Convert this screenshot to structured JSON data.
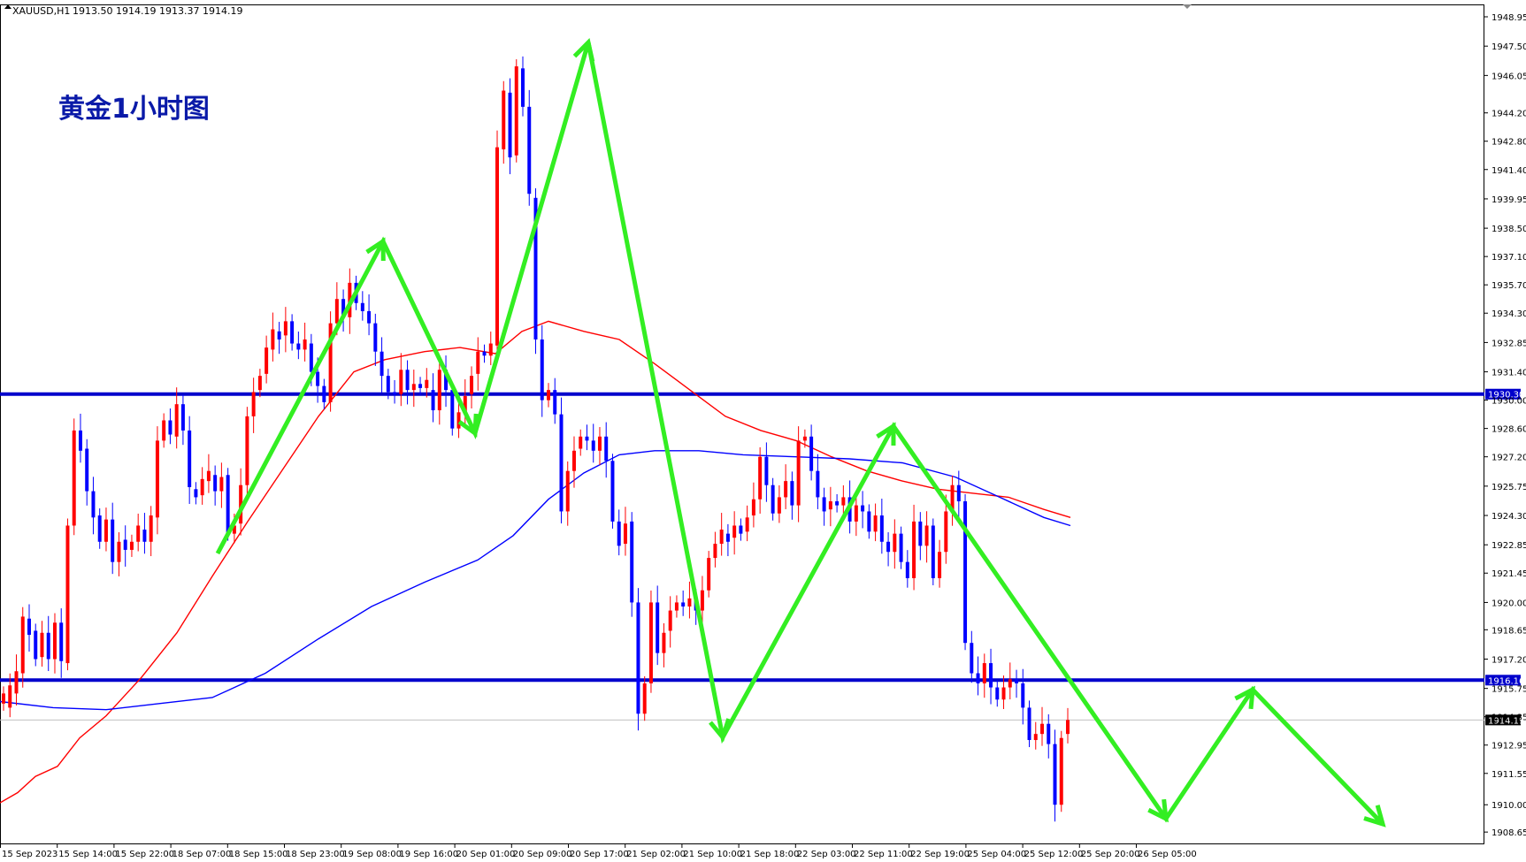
{
  "header": {
    "symbol": "XAUUSD,H1",
    "ohlc": "1913.50 1914.19 1913.37 1914.19"
  },
  "annotation_title": "黄金1小时图",
  "colors": {
    "bull": "#ff0000",
    "bear": "#0000ff",
    "level": "#0000cc",
    "arrow": "#33ee22",
    "ma_fast": "#ff0000",
    "ma_slow": "#0000ff",
    "badge": "#000000"
  },
  "chart_data": {
    "type": "line",
    "title": "黄金1小时图",
    "symbol": "XAUUSD",
    "timeframe": "H1",
    "ylim": [
      1908.35,
      1948.95
    ],
    "y_ticks": [
      "1948.95",
      "1947.50",
      "1946.05",
      "1944.20",
      "1942.80",
      "1941.40",
      "1939.95",
      "1938.50",
      "1937.10",
      "1935.70",
      "1934.30",
      "1932.85",
      "1931.40",
      "1930.00",
      "1928.60",
      "1927.20",
      "1925.75",
      "1924.30",
      "1922.85",
      "1921.45",
      "1920.00",
      "1918.65",
      "1917.20",
      "1915.75",
      "1914.35",
      "1912.95",
      "1911.55",
      "1910.00",
      "1908.65"
    ],
    "x_ticks": [
      "15 Sep 2023",
      "15 Sep 14:00",
      "15 Sep 22:00",
      "18 Sep 07:00",
      "18 Sep 15:00",
      "18 Sep 23:00",
      "19 Sep 08:00",
      "19 Sep 16:00",
      "20 Sep 01:00",
      "20 Sep 09:00",
      "20 Sep 17:00",
      "21 Sep 02:00",
      "21 Sep 10:00",
      "21 Sep 18:00",
      "22 Sep 03:00",
      "22 Sep 11:00",
      "22 Sep 19:00",
      "25 Sep 04:00",
      "25 Sep 12:00",
      "25 Sep 20:00",
      "26 Sep 05:00"
    ],
    "price_levels": [
      1930.3,
      1916.16
    ],
    "current_price": 1914.19,
    "candles": [
      [
        1915.0,
        1915.5
      ],
      [
        1914.8,
        1915.9
      ],
      [
        1915.5,
        1916.6
      ],
      [
        1916.5,
        1919.3
      ],
      [
        1919.2,
        1918.4
      ],
      [
        1918.6,
        1917.2
      ],
      [
        1917.3,
        1918.5
      ],
      [
        1918.5,
        1917.2
      ],
      [
        1917.2,
        1919.0
      ],
      [
        1919.0,
        1917.1
      ],
      [
        1917.0,
        1923.8
      ],
      [
        1923.8,
        1928.5
      ],
      [
        1928.5,
        1927.5
      ],
      [
        1927.6,
        1925.5
      ],
      [
        1925.5,
        1924.2
      ],
      [
        1924.3,
        1923.0
      ],
      [
        1923.0,
        1924.1
      ],
      [
        1924.1,
        1922.0
      ],
      [
        1922.0,
        1923.0
      ],
      [
        1923.1,
        1922.6
      ],
      [
        1922.6,
        1923.0
      ],
      [
        1923.0,
        1923.8
      ],
      [
        1923.6,
        1923.0
      ],
      [
        1923.0,
        1924.3
      ],
      [
        1924.2,
        1928.0
      ],
      [
        1928.0,
        1929.0
      ],
      [
        1929.0,
        1928.3
      ],
      [
        1928.2,
        1929.8
      ],
      [
        1929.8,
        1928.5
      ],
      [
        1928.5,
        1925.7
      ],
      [
        1925.6,
        1925.2
      ],
      [
        1925.3,
        1926.1
      ],
      [
        1926.0,
        1926.5
      ],
      [
        1926.3,
        1925.5
      ],
      [
        1925.5,
        1926.2
      ],
      [
        1926.3,
        1923.4
      ],
      [
        1923.4,
        1923.8
      ],
      [
        1923.9,
        1925.8
      ],
      [
        1925.8,
        1929.2
      ],
      [
        1929.2,
        1930.4
      ],
      [
        1930.5,
        1931.2
      ],
      [
        1931.3,
        1932.6
      ],
      [
        1932.5,
        1933.5
      ],
      [
        1933.4,
        1933.0
      ],
      [
        1933.2,
        1933.9
      ],
      [
        1933.9,
        1932.8
      ],
      [
        1932.8,
        1932.5
      ],
      [
        1932.5,
        1933.0
      ],
      [
        1932.8,
        1931.4
      ],
      [
        1931.4,
        1930.7
      ],
      [
        1930.7,
        1929.9
      ],
      [
        1929.9,
        1933.8
      ],
      [
        1933.8,
        1935.0
      ],
      [
        1935.0,
        1934.1
      ],
      [
        1934.1,
        1935.8
      ],
      [
        1935.8,
        1934.8
      ],
      [
        1934.8,
        1934.4
      ],
      [
        1934.4,
        1933.8
      ],
      [
        1933.8,
        1932.4
      ],
      [
        1932.4,
        1931.2
      ],
      [
        1931.2,
        1930.4
      ],
      [
        1930.4,
        1930.3
      ],
      [
        1930.3,
        1931.5
      ],
      [
        1931.5,
        1930.5
      ],
      [
        1930.5,
        1930.8
      ],
      [
        1930.8,
        1930.6
      ],
      [
        1930.6,
        1931.0
      ],
      [
        1930.5,
        1929.5
      ],
      [
        1929.5,
        1931.5
      ],
      [
        1931.5,
        1930.5
      ],
      [
        1930.5,
        1928.6
      ],
      [
        1928.6,
        1929.4
      ],
      [
        1929.4,
        1930.2
      ],
      [
        1930.3,
        1931.2
      ],
      [
        1931.3,
        1932.4
      ],
      [
        1932.4,
        1932.2
      ],
      [
        1932.2,
        1932.8
      ],
      [
        1932.7,
        1942.5
      ],
      [
        1942.4,
        1945.3
      ],
      [
        1945.2,
        1942.0
      ],
      [
        1942.1,
        1946.5
      ],
      [
        1946.4,
        1944.5
      ],
      [
        1944.5,
        1940.2
      ],
      [
        1940.0,
        1933.0
      ],
      [
        1933.0,
        1930.0
      ],
      [
        1930.0,
        1930.5
      ],
      [
        1930.5,
        1929.3
      ],
      [
        1929.3,
        1924.5
      ],
      [
        1924.5,
        1926.5
      ],
      [
        1926.5,
        1927.5
      ],
      [
        1927.6,
        1928.2
      ],
      [
        1928.2,
        1928.0
      ],
      [
        1928.0,
        1927.5
      ],
      [
        1927.5,
        1928.2
      ],
      [
        1928.2,
        1927.0
      ],
      [
        1927.0,
        1924.0
      ],
      [
        1924.0,
        1922.8
      ],
      [
        1922.9,
        1923.9
      ],
      [
        1924.0,
        1920.0
      ],
      [
        1920.0,
        1914.5
      ],
      [
        1914.5,
        1916.0
      ],
      [
        1916.0,
        1920.0
      ],
      [
        1920.0,
        1917.5
      ],
      [
        1917.5,
        1918.5
      ],
      [
        1918.6,
        1919.6
      ],
      [
        1919.6,
        1920.0
      ],
      [
        1920.0,
        1919.8
      ],
      [
        1919.8,
        1920.2
      ],
      [
        1920.2,
        1919.6
      ],
      [
        1919.6,
        1920.6
      ],
      [
        1920.6,
        1922.2
      ],
      [
        1922.2,
        1922.9
      ],
      [
        1922.9,
        1923.6
      ],
      [
        1923.4,
        1923.0
      ],
      [
        1923.2,
        1923.8
      ],
      [
        1923.8,
        1923.4
      ],
      [
        1923.5,
        1924.2
      ],
      [
        1924.3,
        1925.1
      ],
      [
        1925.1,
        1927.2
      ],
      [
        1927.2,
        1925.8
      ],
      [
        1925.8,
        1924.4
      ],
      [
        1924.4,
        1925.2
      ],
      [
        1925.2,
        1926.0
      ],
      [
        1926.0,
        1924.8
      ],
      [
        1924.8,
        1928.0
      ],
      [
        1928.0,
        1928.2
      ],
      [
        1928.2,
        1926.5
      ],
      [
        1926.5,
        1925.2
      ],
      [
        1925.2,
        1924.5
      ],
      [
        1924.6,
        1925.0
      ],
      [
        1925.0,
        1924.8
      ],
      [
        1924.8,
        1925.2
      ],
      [
        1925.2,
        1924.0
      ],
      [
        1924.0,
        1924.8
      ],
      [
        1924.8,
        1924.5
      ],
      [
        1924.5,
        1923.5
      ],
      [
        1923.5,
        1924.3
      ],
      [
        1924.3,
        1923.0
      ],
      [
        1923.0,
        1922.5
      ],
      [
        1922.5,
        1923.4
      ],
      [
        1923.4,
        1922.0
      ],
      [
        1922.0,
        1921.2
      ],
      [
        1921.2,
        1924.0
      ],
      [
        1924.0,
        1922.8
      ],
      [
        1922.8,
        1923.8
      ],
      [
        1923.8,
        1921.2
      ],
      [
        1921.2,
        1922.5
      ],
      [
        1922.5,
        1924.5
      ],
      [
        1924.5,
        1925.8
      ],
      [
        1925.8,
        1925.0
      ],
      [
        1925.0,
        1918.0
      ],
      [
        1918.0,
        1916.5
      ],
      [
        1916.5,
        1916.0
      ],
      [
        1916.0,
        1917.0
      ],
      [
        1917.0,
        1915.8
      ],
      [
        1915.8,
        1915.2
      ],
      [
        1915.2,
        1915.8
      ],
      [
        1915.8,
        1916.2
      ],
      [
        1916.2,
        1916.0
      ],
      [
        1916.0,
        1914.8
      ],
      [
        1914.8,
        1913.2
      ],
      [
        1913.2,
        1913.5
      ],
      [
        1913.5,
        1914.0
      ],
      [
        1914.0,
        1913.0
      ],
      [
        1913.0,
        1910.0
      ],
      [
        1910.0,
        1913.3
      ],
      [
        1913.5,
        1914.19
      ]
    ],
    "series": [
      {
        "name": "MA",
        "color": "#ff0000",
        "values": [
          [
            0,
            1910.1
          ],
          [
            20,
            1910.6
          ],
          [
            40,
            1911.4
          ],
          [
            65,
            1911.9
          ],
          [
            90,
            1913.3
          ],
          [
            120,
            1914.4
          ],
          [
            160,
            1916.3
          ],
          [
            200,
            1918.5
          ],
          [
            240,
            1921.3
          ],
          [
            280,
            1924.0
          ],
          [
            320,
            1926.6
          ],
          [
            360,
            1929.2
          ],
          [
            400,
            1931.4
          ],
          [
            435,
            1932.0
          ],
          [
            480,
            1932.4
          ],
          [
            520,
            1932.6
          ],
          [
            560,
            1932.3
          ],
          [
            590,
            1933.4
          ],
          [
            620,
            1933.9
          ],
          [
            660,
            1933.4
          ],
          [
            700,
            1933.0
          ],
          [
            740,
            1931.8
          ],
          [
            780,
            1930.5
          ],
          [
            820,
            1929.2
          ],
          [
            860,
            1928.5
          ],
          [
            900,
            1928.0
          ],
          [
            940,
            1927.2
          ],
          [
            980,
            1926.5
          ],
          [
            1020,
            1926.0
          ],
          [
            1060,
            1925.6
          ],
          [
            1100,
            1925.4
          ],
          [
            1140,
            1925.2
          ],
          [
            1180,
            1924.6
          ],
          [
            1210,
            1924.2
          ]
        ]
      },
      {
        "name": "MA",
        "color": "#0000ff",
        "values": [
          [
            0,
            1915.1
          ],
          [
            60,
            1914.8
          ],
          [
            120,
            1914.7
          ],
          [
            180,
            1915.0
          ],
          [
            240,
            1915.3
          ],
          [
            300,
            1916.5
          ],
          [
            360,
            1918.2
          ],
          [
            420,
            1919.8
          ],
          [
            480,
            1921.0
          ],
          [
            540,
            1922.1
          ],
          [
            580,
            1923.3
          ],
          [
            620,
            1925.1
          ],
          [
            660,
            1926.4
          ],
          [
            700,
            1927.3
          ],
          [
            740,
            1927.5
          ],
          [
            790,
            1927.5
          ],
          [
            840,
            1927.3
          ],
          [
            900,
            1927.2
          ],
          [
            960,
            1927.1
          ],
          [
            1020,
            1926.9
          ],
          [
            1080,
            1926.2
          ],
          [
            1130,
            1925.2
          ],
          [
            1180,
            1924.2
          ],
          [
            1210,
            1923.8
          ]
        ]
      }
    ]
  }
}
